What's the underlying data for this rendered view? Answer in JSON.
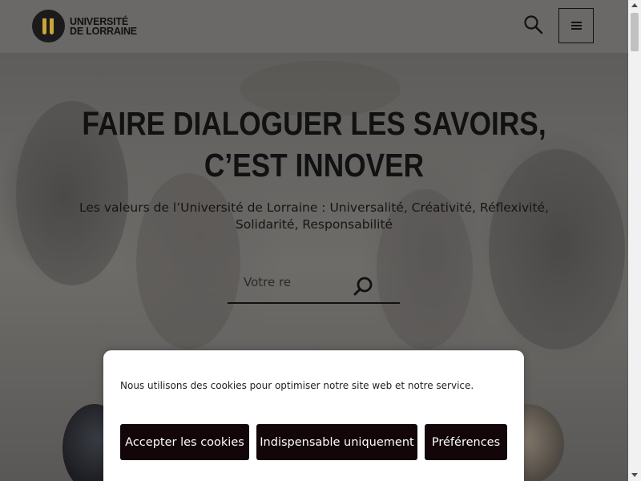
{
  "header": {
    "logo_line1": "UNIVERSITÉ",
    "logo_line2": "DE LORRAINE"
  },
  "hero": {
    "title_line1": "FAIRE DIALOGUER LES SAVOIRS,",
    "title_line2": "C’EST INNOVER",
    "subtitle_line1": "Les valeurs de l’Université de Lorraine : Universalité, Créativité, Réflexivité,",
    "subtitle_line2": "Solidarité, Responsabilité",
    "search_placeholder": "Votre re"
  },
  "cookie_banner": {
    "message": "Nous utilisons des cookies pour optimiser notre site web et notre service.",
    "accept_label": "Accepter les cookies",
    "essential_label": "Indispensable uniquement",
    "preferences_label": "Préférences"
  },
  "colors": {
    "accent_gold": "#caa53b",
    "button_dark": "#120608",
    "header_bg": "#6a6967"
  },
  "icons": [
    "search-icon",
    "hamburger-menu-icon",
    "logo-mark"
  ]
}
